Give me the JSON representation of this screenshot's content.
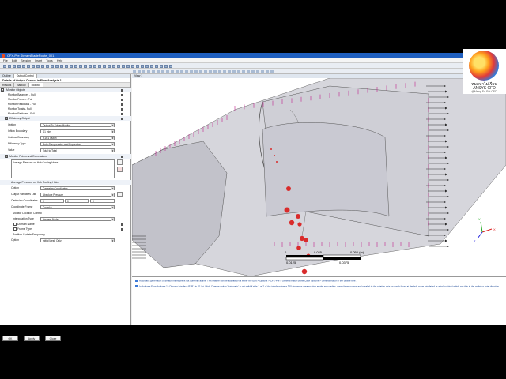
{
  "window": {
    "title": "CFX-Pre  StreamBladeRoute_001"
  },
  "menu": [
    "File",
    "Edit",
    "Session",
    "Insert",
    "Tools",
    "Help"
  ],
  "outline_tabs": [
    "Outline",
    "Output Control"
  ],
  "panel": {
    "title": "Details of Output Control in Flow Analysis 1",
    "subtabs": [
      "Results",
      "Backup",
      "Monitor"
    ],
    "monitor_objects_label": "Monitor Objects",
    "rows": [
      "Monitor Balances - Full",
      "Monitor Forces - Full",
      "Monitor Residuals - Full",
      "Monitor Totals - Full",
      "Monitor Particles - Full"
    ],
    "efficiency_output_label": "Efficiency Output",
    "option_label": "Option",
    "option_value": "Output To Solver Monitor",
    "inflow_label": "Inflow Boundary",
    "inflow_value": "S1 Inlet",
    "outflow_label": "Outflow Boundary",
    "outflow_value": "R1R1 Outlet",
    "efficiency_type_label": "Efficiency Type",
    "efficiency_type_value": "Both Compression and Expansion",
    "value_label": "Value",
    "value_value": "Total to Total",
    "monitor_points_label": "Monitor Points and Expressions",
    "list_item": "Average Pressure on Hub Cooling Holes",
    "sub_title": "Average Pressure on Hub Cooling Holes",
    "sub_option_label": "Option",
    "sub_option_value": "Cartesian Coordinates",
    "output_var_label": "Output Variables List",
    "output_var_value": "Absolute Pressure",
    "cart_label": "Cartesian Coordinates",
    "cart_values": [
      "0",
      "0",
      "0"
    ],
    "coord_frame_label": "Coordinate Frame",
    "coord_frame_value": "Coord 0",
    "monitor_location_label": "Monitor Location Control",
    "interp_label": "Interpolation Type",
    "interp_value": "Nearest Node",
    "domain_name_label": "Domain Name",
    "frame_type_label": "Frame Type",
    "position_update_label": "Position Update Frequency",
    "pos_option_label": "Option",
    "pos_option_value": "Initial Mesh Only"
  },
  "buttons": {
    "ok": "OK",
    "apply": "Apply",
    "close": "Close"
  },
  "viewer": {
    "tab": "View 1",
    "scale": {
      "labels_top": [
        "0",
        "0.025",
        "0.050 (m)"
      ],
      "labels_bottom": [
        "0.0125",
        "0.0375"
      ]
    },
    "triad": {
      "x": "X",
      "y": "Y",
      "z": "Z"
    }
  },
  "messages": [
    "Automatic generation of default interfaces is not currently active. This feature can be activated via either the Edit > Options > CFX-Pre > General editor or the Case Options > General editor in the outline tree.",
    "In Analysis Flow Analysis 1 - Domain Interface R1R1 to S1 Int. Pitch Change option 'Automatic' is not valid if side 1 or 2 of the interface has a 360 degree or greater pitch angle, zero radius, mesh faces normal and parallel to the rotation axis, or mesh faces at the hub curve (pin failed or axial position) which are thin in the radial or axial direction."
  ],
  "logo": {
    "line1": "หมดหาไม่เรียน",
    "line2": "ANSYS CFD",
    "line3": "@Meng.Fu.Pai.CFD"
  },
  "colors": {
    "accent": "#1f5fbf",
    "blade": "#c9c9d2",
    "vectors": "#2b2b2b",
    "markers": "#d92b2b",
    "mesh": "#c0218c"
  }
}
